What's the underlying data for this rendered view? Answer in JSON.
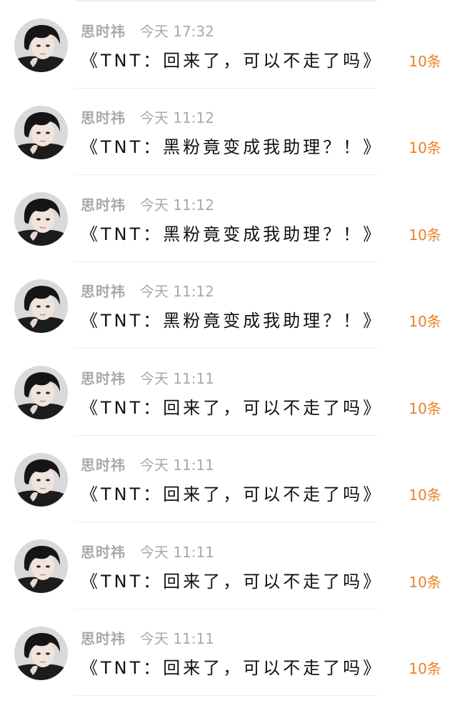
{
  "messages": [
    {
      "sender": "思时祎",
      "time": "今天 17:32",
      "title": "《TNT：回来了，可以不走了吗》",
      "count": "10条",
      "avatar": "avatar-icon"
    },
    {
      "sender": "思时祎",
      "time": "今天 11:12",
      "title": "《TNT：黑粉竟变成我助理？！》",
      "count": "10条",
      "avatar": "avatar-icon"
    },
    {
      "sender": "思时祎",
      "time": "今天 11:12",
      "title": "《TNT：黑粉竟变成我助理？！》",
      "count": "10条",
      "avatar": "avatar-icon"
    },
    {
      "sender": "思时祎",
      "time": "今天 11:12",
      "title": "《TNT：黑粉竟变成我助理？！》",
      "count": "10条",
      "avatar": "avatar-icon"
    },
    {
      "sender": "思时祎",
      "time": "今天 11:11",
      "title": "《TNT：回来了，可以不走了吗》",
      "count": "10条",
      "avatar": "avatar-icon"
    },
    {
      "sender": "思时祎",
      "time": "今天 11:11",
      "title": "《TNT：回来了，可以不走了吗》",
      "count": "10条",
      "avatar": "avatar-icon"
    },
    {
      "sender": "思时祎",
      "time": "今天 11:11",
      "title": "《TNT：回来了，可以不走了吗》",
      "count": "10条",
      "avatar": "avatar-icon"
    },
    {
      "sender": "思时祎",
      "time": "今天 11:11",
      "title": "《TNT：回来了，可以不走了吗》",
      "count": "10条",
      "avatar": "avatar-icon"
    }
  ],
  "colors": {
    "meta_text": "#a9a9a9",
    "title_text": "#111111",
    "count_text": "#e8822a",
    "divider": "#ededed"
  }
}
